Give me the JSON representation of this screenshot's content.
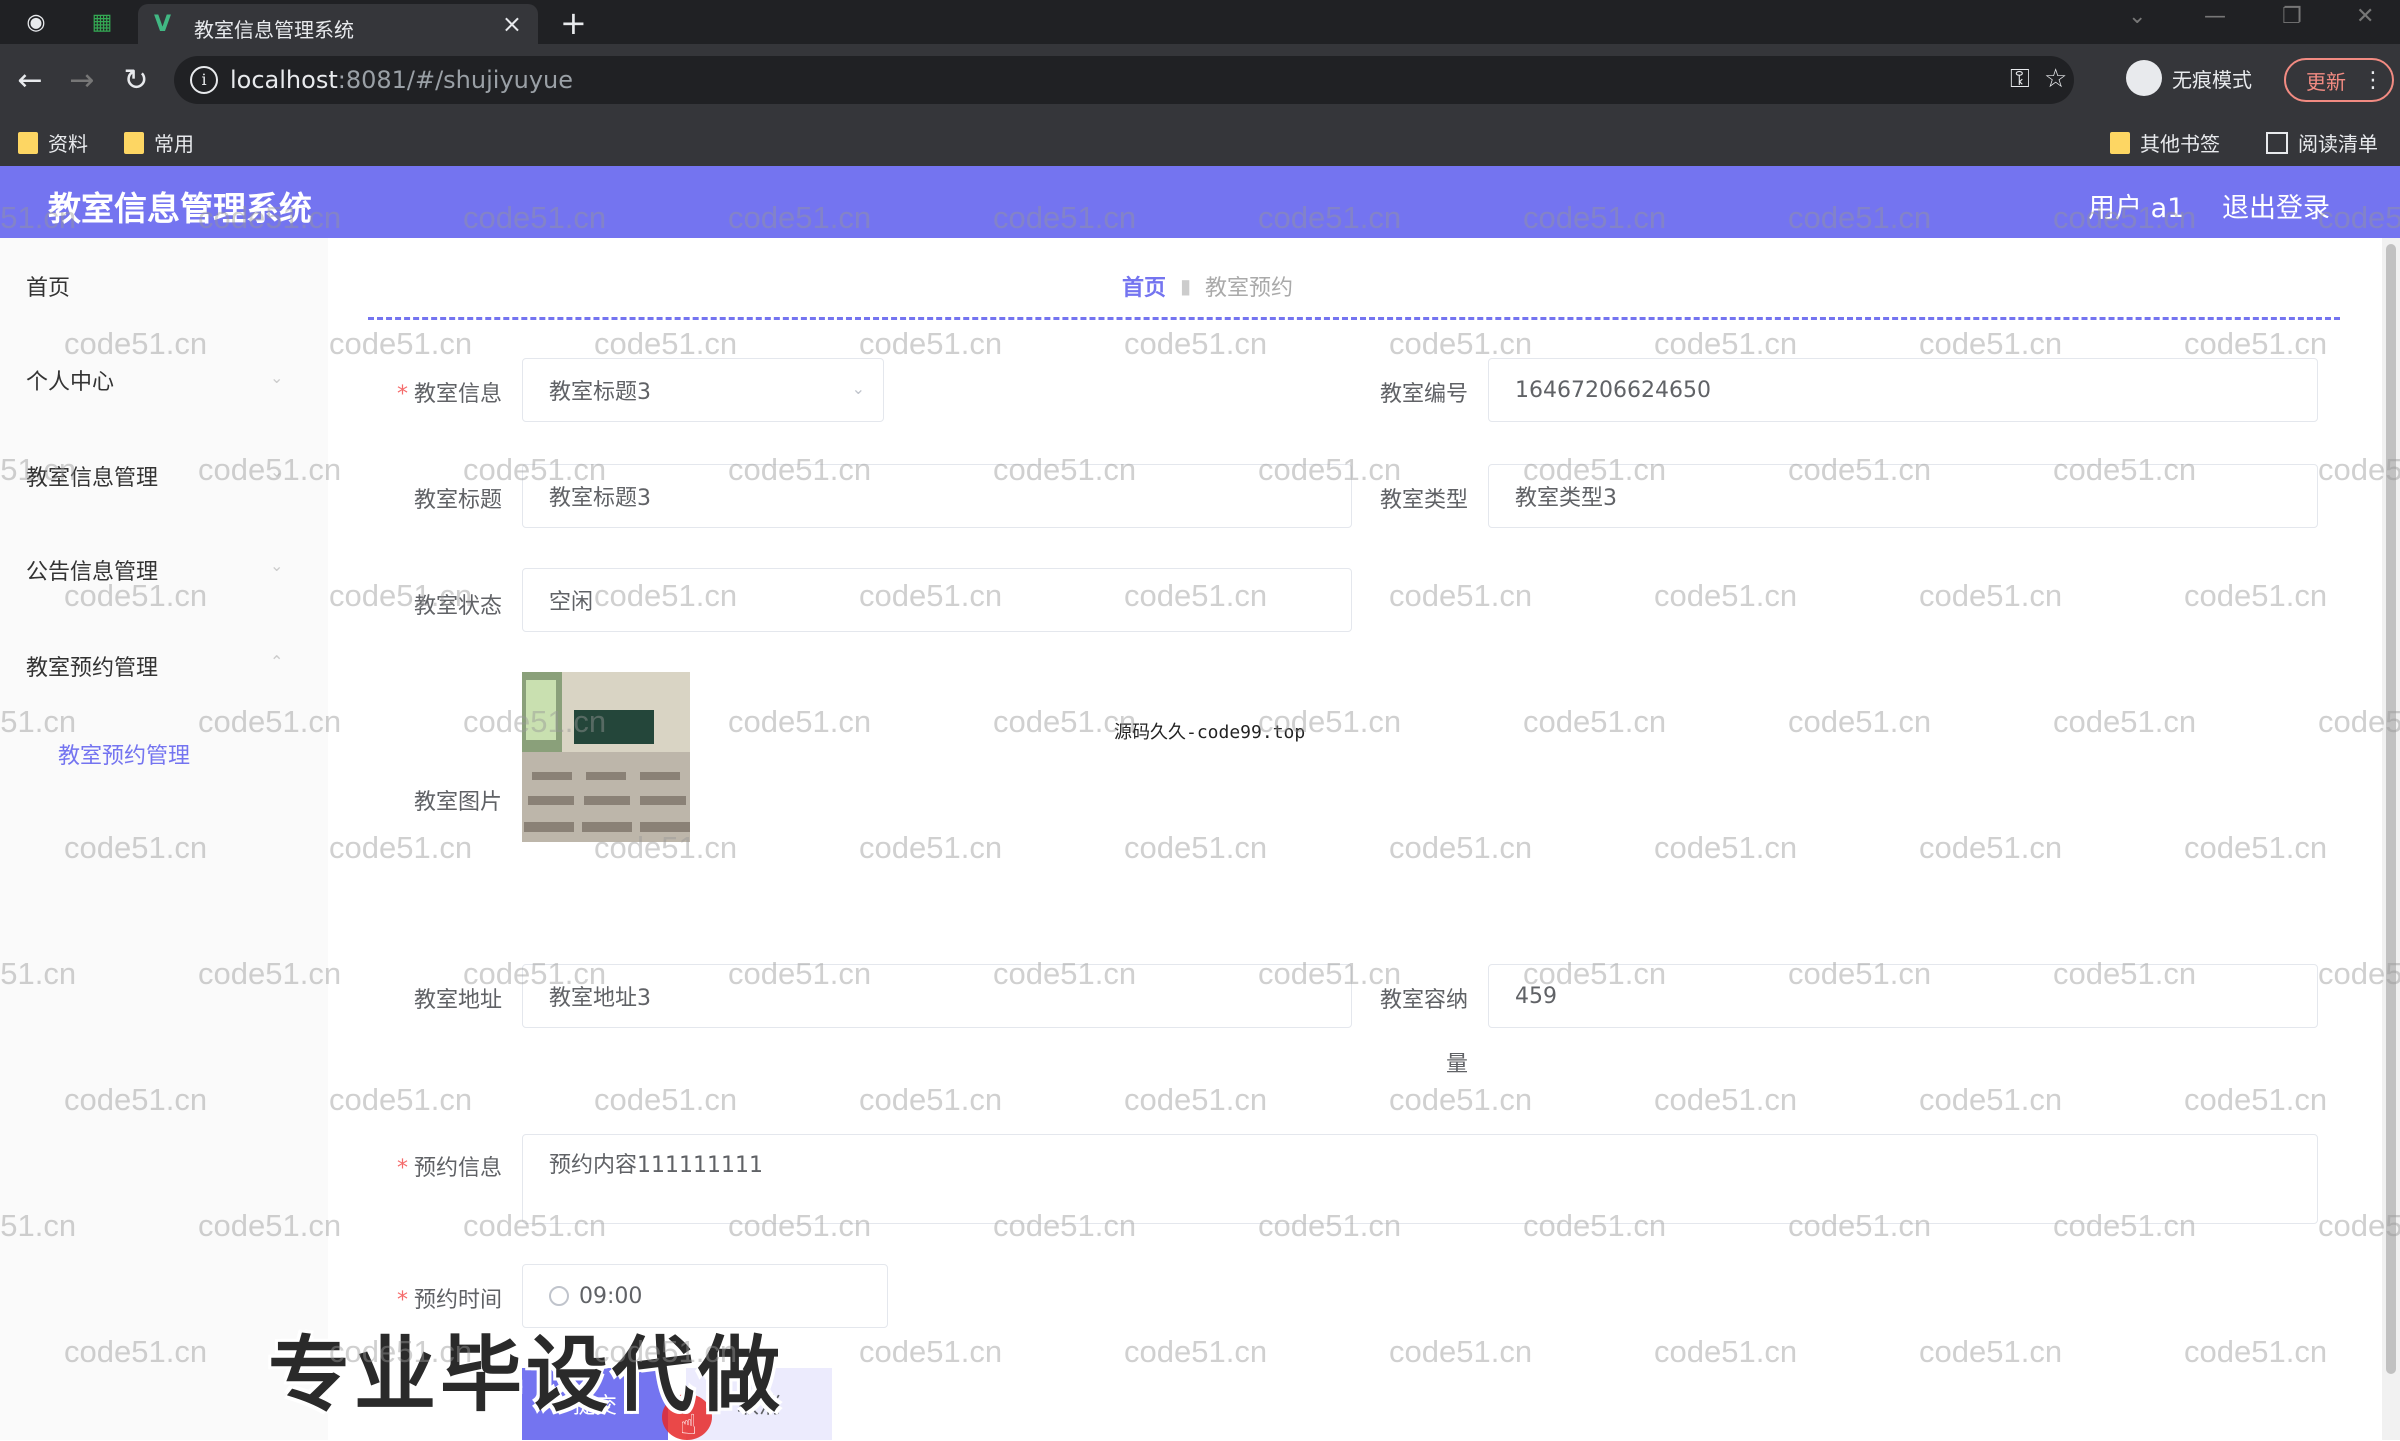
{
  "browser": {
    "tab_title": "教室信息管理系统",
    "url_host": "localhost",
    "url_rest": ":8081/#/shujiyuyue",
    "incognito_label": "无痕模式",
    "update_label": "更新",
    "bookmarks": [
      "资料",
      "常用"
    ],
    "bookmarks_right": [
      "其他书签",
      "阅读清单"
    ]
  },
  "header": {
    "title": "教室信息管理系统",
    "user_label": "用户 a1",
    "logout_label": "退出登录",
    "accent_color": "#7474f0"
  },
  "sidebar": {
    "items": [
      {
        "label": "首页"
      },
      {
        "label": "个人中心"
      },
      {
        "label": "教室信息管理"
      },
      {
        "label": "公告信息管理"
      },
      {
        "label": "教室预约管理"
      }
    ],
    "subitem": "教室预约管理"
  },
  "breadcrumb": {
    "home": "首页",
    "current": "教室预约"
  },
  "form": {
    "classroom_info_label": "教室信息",
    "classroom_info_value": "教室标题3",
    "classroom_no_label": "教室编号",
    "classroom_no_value": "16467206624650",
    "classroom_title_label": "教室标题",
    "classroom_title_value": "教室标题3",
    "classroom_type_label": "教室类型",
    "classroom_type_value": "教室类型3",
    "classroom_status_label": "教室状态",
    "classroom_status_value": "空闲",
    "classroom_image_label": "教室图片",
    "classroom_address_label": "教室地址",
    "classroom_address_value": "教室地址3",
    "capacity_label": "教室容纳",
    "capacity_label_wrap": "量",
    "capacity_value": "459",
    "booking_info_label": "预约信息",
    "booking_info_value": "预约内容111111111",
    "booking_time_label": "预约时间",
    "booking_time_value": "09:00",
    "submit_label": "提交",
    "cancel_label": "取消",
    "required_mark": "*"
  },
  "overlays": {
    "source_text": "源码久久-code99.top",
    "promo_text": "专业毕设代做",
    "watermark": "code51.cn"
  }
}
